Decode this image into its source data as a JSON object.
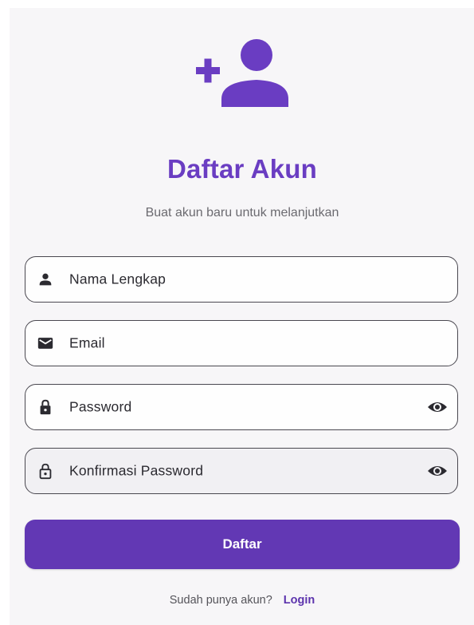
{
  "colors": {
    "accent": "#6a3dc2",
    "button_bg": "#6238b4",
    "background": "#f7f6f8",
    "border": "#4a4850"
  },
  "header": {
    "icon": "person-add-icon",
    "title": "Daftar Akun",
    "subtitle": "Buat akun baru untuk melanjutkan"
  },
  "form": {
    "name": {
      "placeholder": "Nama Lengkap",
      "value": "",
      "icon": "person-icon"
    },
    "email": {
      "placeholder": "Email",
      "value": "",
      "icon": "mail-icon"
    },
    "password": {
      "placeholder": "Password",
      "value": "",
      "icon": "lock-icon",
      "toggle_icon": "eye-icon"
    },
    "confirm_password": {
      "placeholder": "Konfirmasi Password",
      "value": "",
      "icon": "lock-outline-icon",
      "toggle_icon": "eye-icon"
    }
  },
  "submit_label": "Daftar",
  "footer": {
    "prompt": "Sudah punya akun?",
    "login_label": "Login"
  }
}
